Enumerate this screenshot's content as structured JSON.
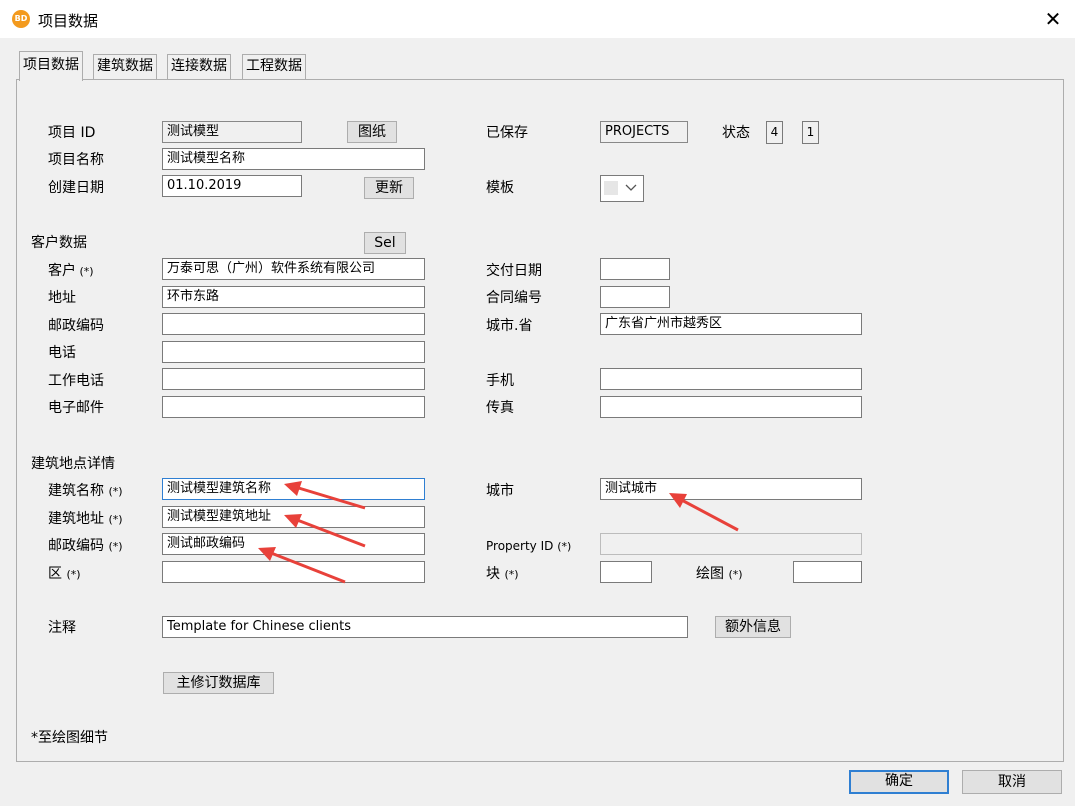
{
  "window": {
    "title": "项目数据",
    "app_icon_text": "BD",
    "close_glyph": "✕"
  },
  "tabs": [
    {
      "label": "项目数据"
    },
    {
      "label": "建筑数据"
    },
    {
      "label": "连接数据"
    },
    {
      "label": "工程数据"
    }
  ],
  "project": {
    "id_label": "项目 ID",
    "id_value": "测试模型",
    "drawing_button": "图纸",
    "name_label": "项目名称",
    "name_value": "测试模型名称",
    "date_label": "创建日期",
    "date_value": "01.10.2019",
    "update_button": "更新",
    "saved_label": "已保存",
    "saved_value": "PROJECTS",
    "status_label": "状态",
    "status_box1": "4",
    "status_box2": "1",
    "template_label": "模板",
    "template_value": ""
  },
  "customer": {
    "section_label": "客户数据",
    "sel_button": "Sel",
    "client_label": "客户",
    "client_value": "万泰可思（广州）软件系统有限公司",
    "address_label": "地址",
    "address_value": "环市东路",
    "postcode_label": "邮政编码",
    "postcode_value": "",
    "phone_label": "电话",
    "phone_value": "",
    "work_phone_label": "工作电话",
    "work_phone_value": "",
    "email_label": "电子邮件",
    "email_value": "",
    "delivery_date_label": "交付日期",
    "delivery_date_value": "",
    "contract_no_label": "合同编号",
    "contract_no_value": "",
    "city_province_label": "城市.省",
    "city_province_value": "广东省广州市越秀区",
    "mobile_label": "手机",
    "mobile_value": "",
    "fax_label": "传真",
    "fax_value": ""
  },
  "site": {
    "section_label": "建筑地点详情",
    "building_name_label": "建筑名称",
    "building_name_value": "测试模型建筑名称",
    "building_address_label": "建筑地址",
    "building_address_value": "测试模型建筑地址",
    "postcode_label": "邮政编码",
    "postcode_value": "测试邮政编码",
    "district_label": "区",
    "district_value": "",
    "city_label": "城市",
    "city_value": "测试城市",
    "property_id_label": "Property ID",
    "property_id_value": "",
    "block_label": "块",
    "block_value": "",
    "drawing_label": "绘图",
    "drawing_value": "",
    "asterisk": "(*)"
  },
  "notes": {
    "label": "注释",
    "value": "Template for Chinese clients",
    "extra_button": "额外信息"
  },
  "master_db_button": "主修订数据库",
  "footnote": "*至绘图细节",
  "footer": {
    "ok_button": "确定",
    "cancel_button": "取消"
  },
  "colors": {
    "annotation_arrow": "#e8413a",
    "focus_border": "#2f7fd2"
  }
}
